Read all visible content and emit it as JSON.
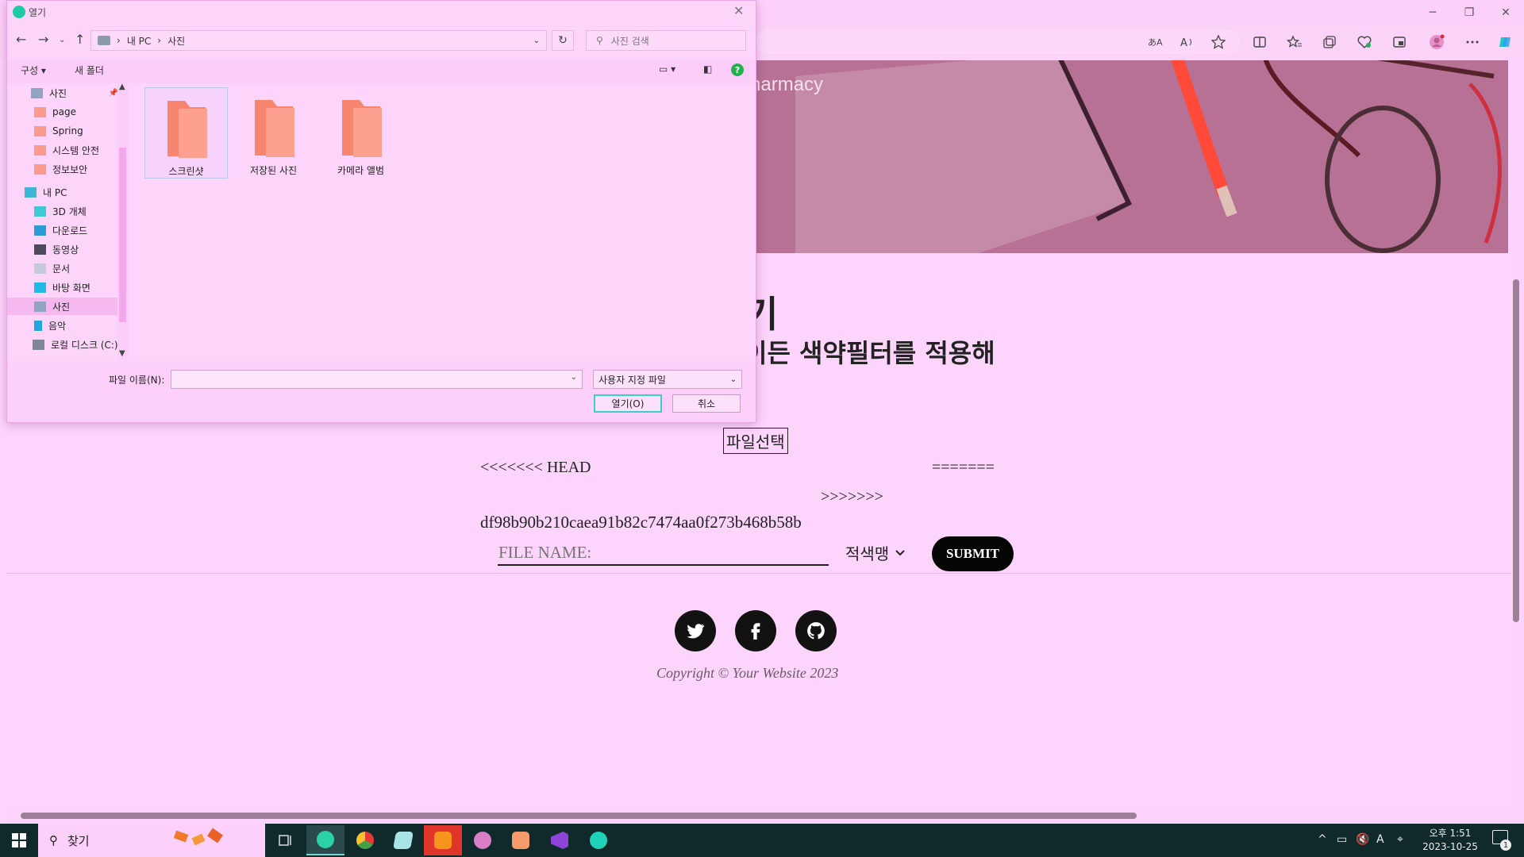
{
  "browser": {
    "window_buttons": [
      "─",
      "❐",
      "✕"
    ],
    "hero_text": "harmacy"
  },
  "page": {
    "heading_1": "기",
    "heading_2": "이든 색약필터를 적용해",
    "file_choose_label": "파일선택",
    "conflict_head": "<<<<<<< HEAD",
    "conflict_separator": "=======",
    "conflict_end": ">>>>>>>",
    "commit_hash": "df98b90b210caea91b82c7474aa0f273b468b58b",
    "filename_placeholder": "FILE NAME:",
    "filter_select_value": "적색맹",
    "submit_label": "SUBMIT",
    "social_icons": [
      "twitter-icon",
      "facebook-icon",
      "github-icon"
    ],
    "copyright": "Copyright © Your Website 2023"
  },
  "dialog": {
    "title": "열기",
    "path": [
      "내 PC",
      "사진"
    ],
    "search_placeholder": "사진 검색",
    "toolbar": {
      "organize": "구성 ▾",
      "new_folder": "새 폴더"
    },
    "nav_items": [
      {
        "label": "사진",
        "icon": "pictures-icon",
        "pinned": true
      },
      {
        "label": "page",
        "icon": "folder-icon"
      },
      {
        "label": "Spring",
        "icon": "folder-icon"
      },
      {
        "label": "시스템 안전",
        "icon": "folder-icon"
      },
      {
        "label": "정보보안",
        "icon": "folder-icon"
      },
      {
        "label": "내 PC",
        "icon": "computer-icon"
      },
      {
        "label": "3D 개체",
        "icon": "3d-objects-icon"
      },
      {
        "label": "다운로드",
        "icon": "download-icon"
      },
      {
        "label": "동영상",
        "icon": "video-icon"
      },
      {
        "label": "문서",
        "icon": "document-icon"
      },
      {
        "label": "바탕 화면",
        "icon": "desktop-icon"
      },
      {
        "label": "사진",
        "icon": "pictures-icon",
        "selected": true
      },
      {
        "label": "음악",
        "icon": "music-icon"
      },
      {
        "label": "로컬 디스크 (C:)",
        "icon": "drive-icon"
      }
    ],
    "folders": [
      "스크린샷",
      "저장된 사진",
      "카메라 앨범"
    ],
    "filename_label": "파일 이름(N):",
    "filename_value": "",
    "filetype_value": "사용자 지정 파일",
    "open_label": "열기(O)",
    "cancel_label": "취소"
  },
  "taskbar": {
    "search_label": "찾기",
    "time": "오후 1:51",
    "date": "2023-10-25",
    "notification_count": "1",
    "ime": "A"
  },
  "colors": {
    "accent": "#fdd4fb",
    "folder": "#fb9a8b",
    "taskbar": "#102a2c",
    "submit": "#050505"
  }
}
